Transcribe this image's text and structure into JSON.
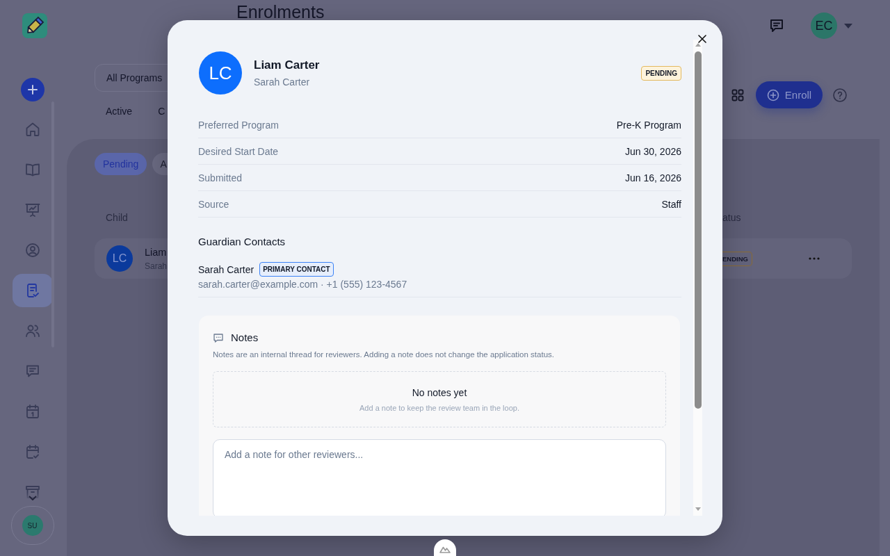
{
  "sidebar": {
    "items": [
      {
        "kind": "home",
        "selected": false
      },
      {
        "kind": "book",
        "selected": false
      },
      {
        "kind": "presentation",
        "selected": false
      },
      {
        "kind": "profile",
        "selected": false
      },
      {
        "kind": "checklist",
        "selected": true
      },
      {
        "kind": "people",
        "selected": false
      },
      {
        "kind": "chat",
        "selected": false
      },
      {
        "kind": "calendar",
        "selected": false
      },
      {
        "kind": "calendar_check",
        "selected": false
      },
      {
        "kind": "box",
        "selected": false
      }
    ],
    "user": {
      "initials": "SU"
    }
  },
  "header": {
    "title": "Enrolments",
    "user": {
      "initials": "EC"
    }
  },
  "filters": {
    "program": {
      "value": "All Programs"
    },
    "tabs": [
      {
        "label": "Active"
      },
      {
        "label": "C"
      }
    ]
  },
  "toolbar": {
    "enroll_button": {
      "label": "Enroll"
    }
  },
  "list": {
    "chips": [
      {
        "label": "Pending",
        "selected": true
      },
      {
        "label": "A",
        "selected": false
      }
    ],
    "columns": [
      "Child",
      "atus"
    ],
    "rows": [
      {
        "initials": "LC",
        "name": "Liam",
        "guardian": "Sarah",
        "status": "ENDING"
      }
    ]
  },
  "modal": {
    "child": {
      "initials": "LC",
      "name": "Liam Carter",
      "guardian": "Sarah Carter",
      "status": "PENDING"
    },
    "details": [
      {
        "label": "Preferred Program",
        "value": "Pre-K Program"
      },
      {
        "label": "Desired Start Date",
        "value": "Jun 30, 2026"
      },
      {
        "label": "Submitted",
        "value": "Jun 16, 2026"
      },
      {
        "label": "Source",
        "value": "Staff"
      }
    ],
    "guardian_contacts": {
      "title": "Guardian Contacts",
      "contacts": [
        {
          "name": "Sarah Carter",
          "badge": "PRIMARY CONTACT",
          "details": "sarah.carter@example.com · +1 (555) 123-4567"
        }
      ]
    },
    "notes": {
      "title": "Notes",
      "description": "Notes are an internal thread for reviewers. Adding a note does not change the application status.",
      "empty_title": "No notes yet",
      "empty_hint": "Add a note to keep the review team in the loop.",
      "input": {
        "placeholder": "Add a note for other reviewers..."
      }
    }
  }
}
